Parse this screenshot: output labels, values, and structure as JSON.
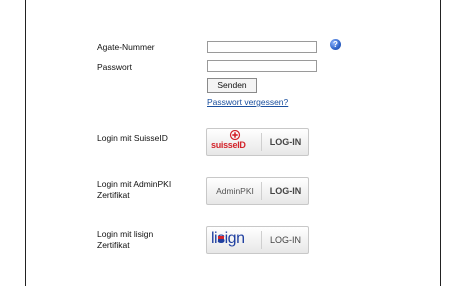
{
  "form": {
    "agate_label": "Agate-Nummer",
    "agate_value": "",
    "password_label": "Passwort",
    "password_value": "",
    "send_label": "Senden",
    "forgot_link": "Passwort vergessen?",
    "help_glyph": "?"
  },
  "logins": [
    {
      "label": "Login mit SuisseID",
      "brand": "suisseID",
      "action": "LOG-IN",
      "brand_color": "#d3242b"
    },
    {
      "label": "Login mit AdminPKI Zertifikat",
      "brand": "AdminPKI",
      "action": "LOG-IN"
    },
    {
      "label": "Login mit lisign Zertifikat",
      "brand": "lisign",
      "action": "LOG-IN",
      "brand_color": "#1f3fa0"
    }
  ],
  "icons": {
    "help": "help-icon",
    "suisseid_emblem": "suisseid-emblem-icon",
    "lisign_flag": "lisign-flag-icon"
  }
}
